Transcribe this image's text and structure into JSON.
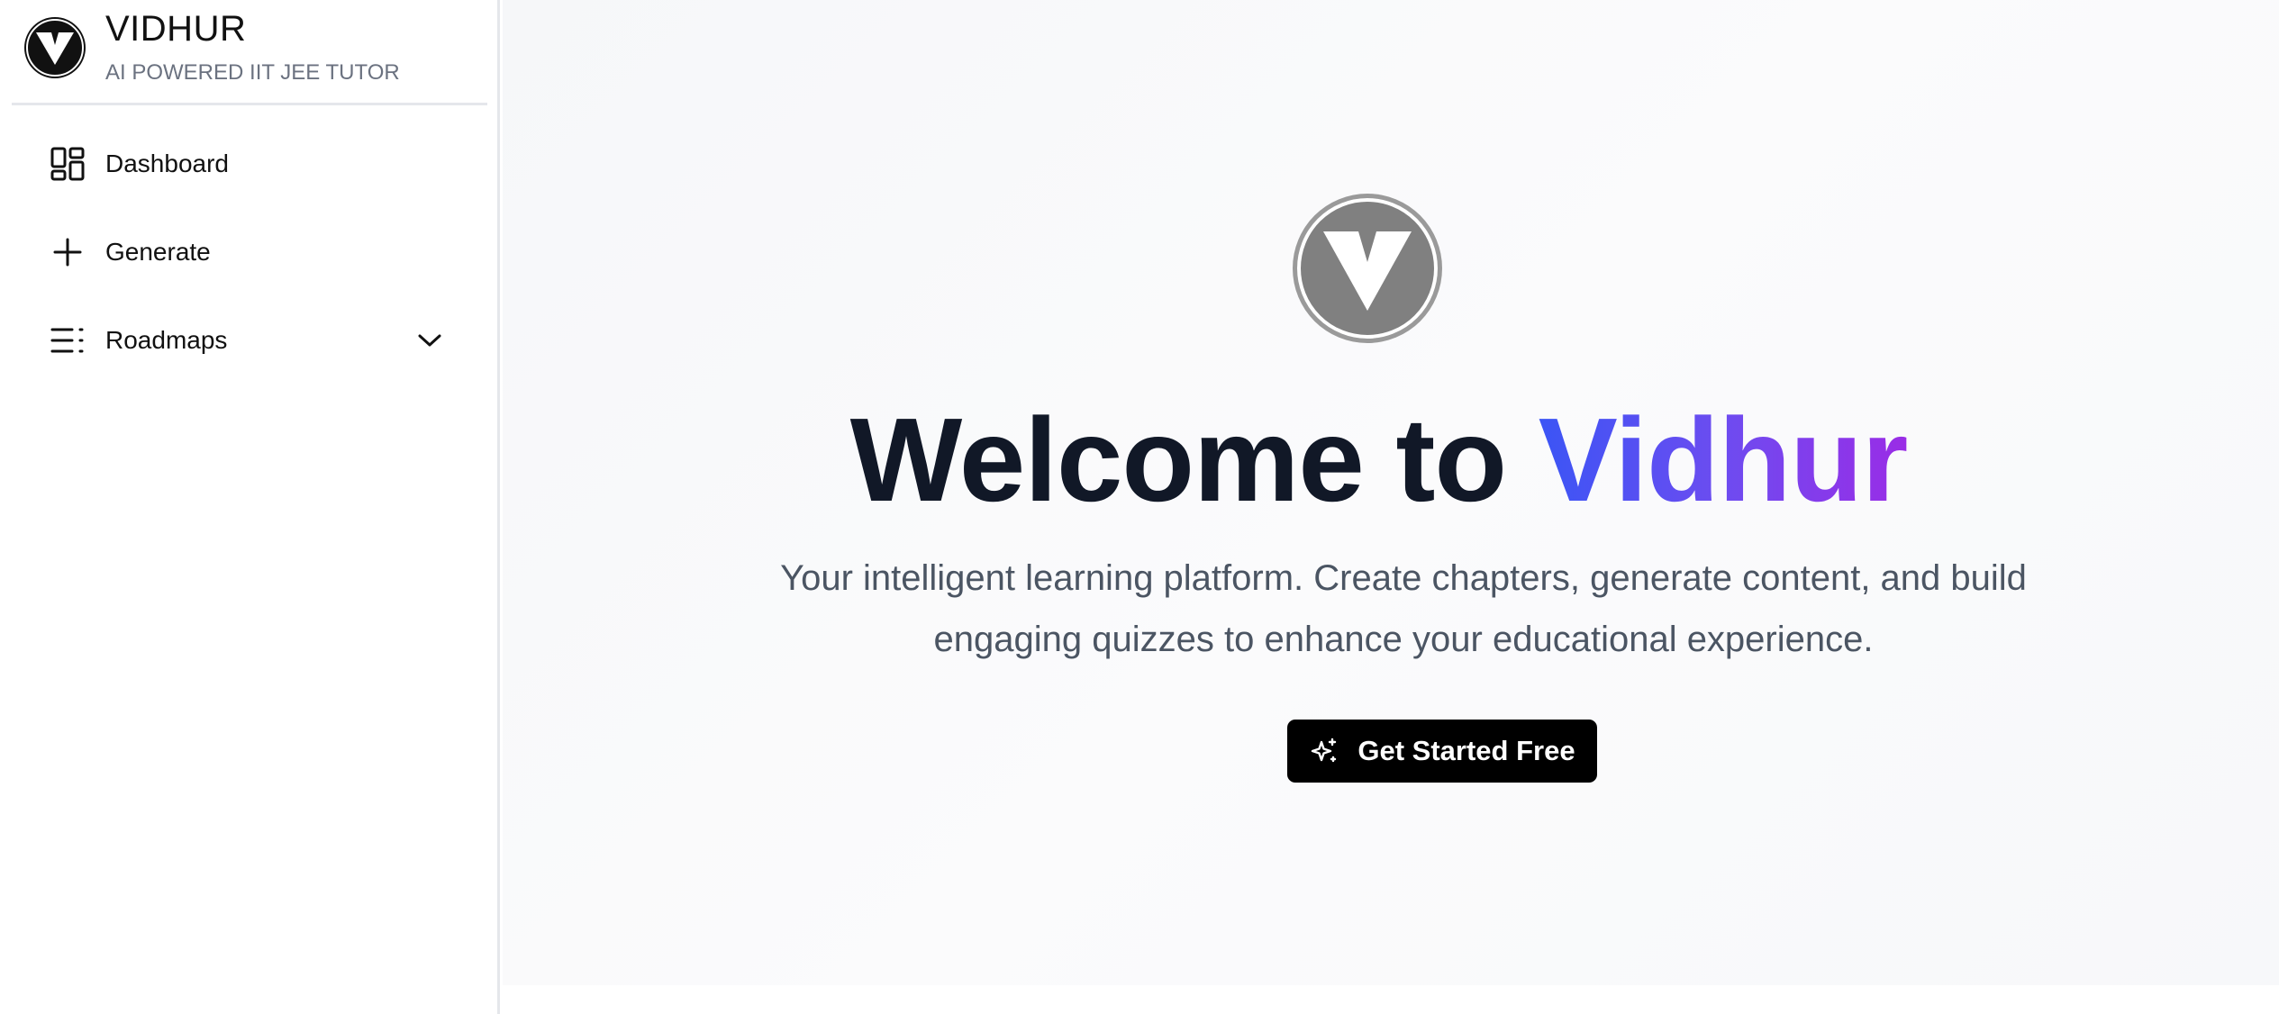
{
  "brand": {
    "title": "VIDHUR",
    "subtitle": "AI POWERED IIT JEE TUTOR",
    "logo_icon": "v-logo-icon"
  },
  "sidebar": {
    "items": [
      {
        "label": "Dashboard",
        "icon": "dashboard-grid-icon"
      },
      {
        "label": "Generate",
        "icon": "plus-icon"
      },
      {
        "label": "Roadmaps",
        "icon": "list-icon",
        "expandable": true,
        "chevron_icon": "chevron-down-icon"
      }
    ]
  },
  "hero": {
    "logo_icon": "v-logo-icon",
    "title_prefix": "Welcome to ",
    "title_accent": "Vidhur",
    "description": "Your intelligent learning platform. Create chapters, generate content, and build engaging quizzes to enhance your educational experience.",
    "cta_label": "Get Started Free",
    "cta_icon": "sparkle-icon"
  },
  "colors": {
    "accent_start": "#3b55f5",
    "accent_end": "#9a2ce6",
    "cta_background": "#000000",
    "title_text": "#111827",
    "body_text": "#4b5563"
  }
}
